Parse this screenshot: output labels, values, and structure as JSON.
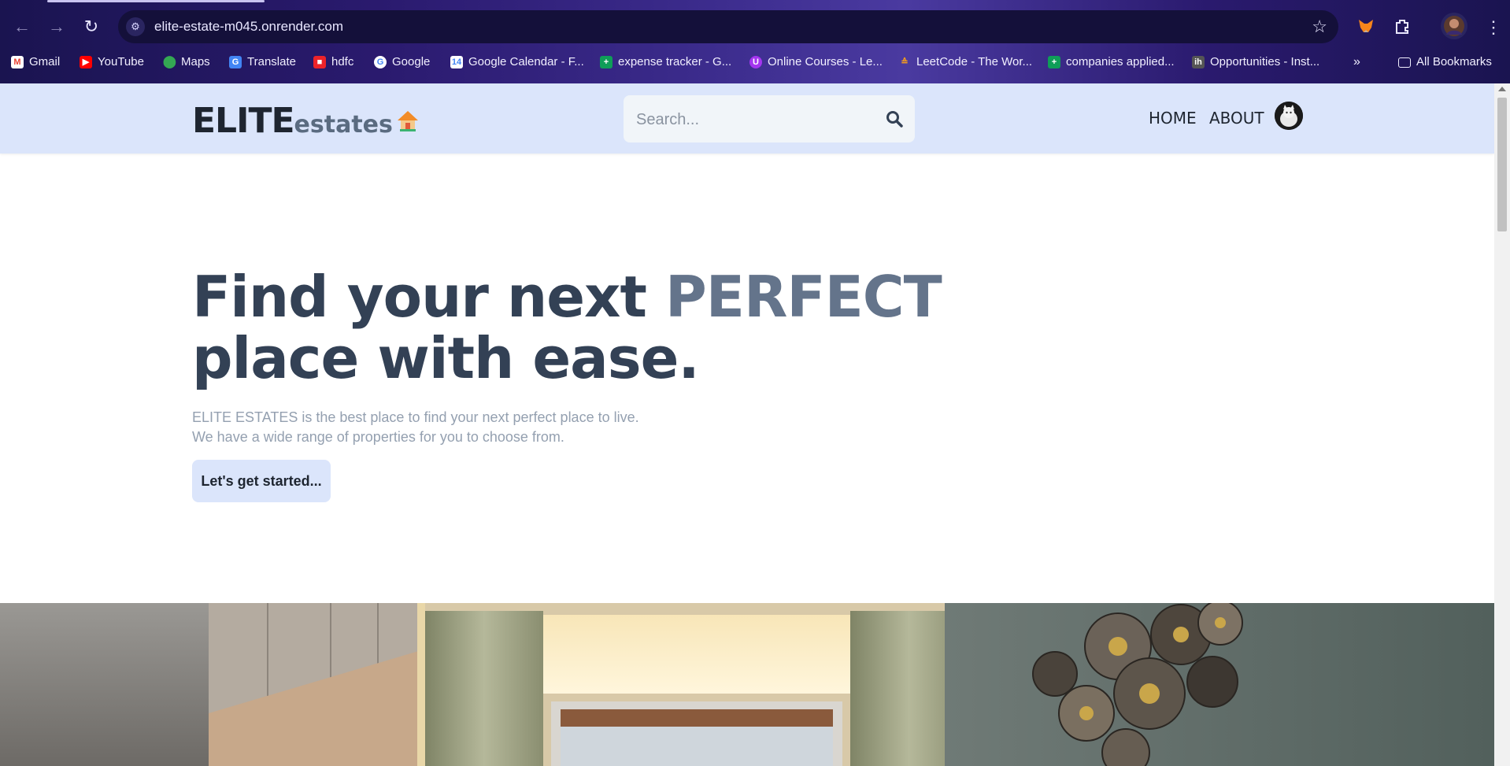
{
  "browser": {
    "url": "elite-estate-m045.onrender.com",
    "bookmarks": [
      {
        "label": "Gmail",
        "icon": "gmail-icon"
      },
      {
        "label": "YouTube",
        "icon": "youtube-icon"
      },
      {
        "label": "Maps",
        "icon": "maps-icon"
      },
      {
        "label": "Translate",
        "icon": "translate-icon"
      },
      {
        "label": "hdfc",
        "icon": "hdfc-icon"
      },
      {
        "label": "Google",
        "icon": "google-icon"
      },
      {
        "label": "Google Calendar - F...",
        "icon": "calendar-icon"
      },
      {
        "label": "expense tracker - G...",
        "icon": "sheets-icon"
      },
      {
        "label": "Online Courses - Le...",
        "icon": "udemy-icon"
      },
      {
        "label": "LeetCode - The Wor...",
        "icon": "leetcode-icon"
      },
      {
        "label": "companies applied...",
        "icon": "sheets-icon"
      },
      {
        "label": "Opportunities - Inst...",
        "icon": "internshala-icon"
      }
    ],
    "all_bookmarks": "All Bookmarks",
    "overflow": "»"
  },
  "header": {
    "logo_main": "ELITE",
    "logo_sub": "estates",
    "search_placeholder": "Search...",
    "nav": {
      "home": "HOME",
      "about": "ABOUT"
    }
  },
  "hero": {
    "title_part1": "Find your next ",
    "title_accent": "PERFECT",
    "title_part2": "place with ease.",
    "subtitle_line1": "ELITE ESTATES is the best place to find your next perfect place to live.",
    "subtitle_line2": "We have a wide range of properties for you to choose from.",
    "cta_label": "Let's get started..."
  },
  "colors": {
    "header_bg": "#dbe5fb",
    "title": "#334155",
    "accent": "#64748b"
  }
}
